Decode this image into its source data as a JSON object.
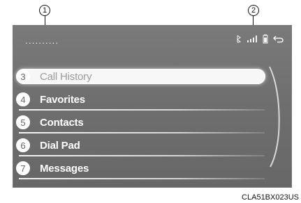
{
  "screen": {
    "title_placeholder": "..........",
    "status_icons": {
      "bluetooth": "bluetooth-icon",
      "signal": "signal-icon",
      "battery": "battery-icon",
      "back": "back-arrow-icon"
    }
  },
  "callouts": {
    "one": "1",
    "two": "2"
  },
  "menu": {
    "items": [
      {
        "number": "3",
        "label": "Call History"
      },
      {
        "number": "4",
        "label": "Favorites"
      },
      {
        "number": "5",
        "label": "Contacts"
      },
      {
        "number": "6",
        "label": "Dial Pad"
      },
      {
        "number": "7",
        "label": "Messages"
      }
    ]
  },
  "caption": "CLA51BX023US",
  "colors": {
    "screen_bg": "#727272",
    "selected_bg": "#f7f7f7",
    "text_white": "#ffffff"
  }
}
